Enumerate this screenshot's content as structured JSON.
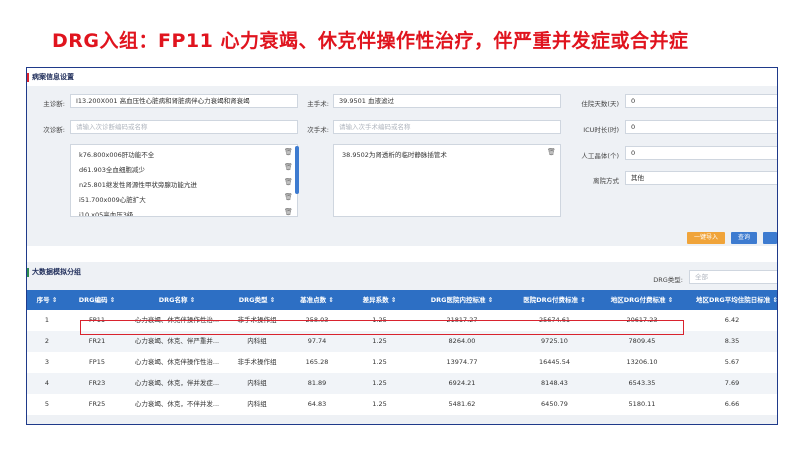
{
  "slide_title": "DRG入组：FP11 心力衰竭、休克伴操作性治疗，伴严重并发症或合并症",
  "section1": {
    "title": "病案信息设置",
    "main_diag_label": "主诊断:",
    "main_diag_value": "I13.200X001 高血压性心脏病和肾脏病伴心力衰竭和肾衰竭",
    "secondary_diag_label": "次诊断:",
    "secondary_diag_placeholder": "请输入次诊断编码或名称",
    "secondary_list": [
      "k76.800x006肝功能不全",
      "d61.903全血细胞减少",
      "n25.801继发性肾源性甲状旁腺功能亢进",
      "i51.700x009心脏扩大",
      "i10.x05高血压3级"
    ],
    "main_op_label": "主手术:",
    "main_op_value": "39.9501 血液滤过",
    "secondary_op_label": "次手术:",
    "secondary_op_placeholder": "请输入次手术编码或名称",
    "secondary_op_list": [
      "38.9502为肾透析的临时静脉插管术"
    ],
    "los_label": "住院天数(天)",
    "los_value": "0",
    "icu_label": "ICU时长(时)",
    "icu_value": "0",
    "ventilator_label": "人工晶体(个)",
    "ventilator_value": "0",
    "discharge_label": "离院方式",
    "discharge_value": "其他",
    "import_button": "一键导入",
    "query_button": "查询"
  },
  "section2": {
    "title": "大数据模拟分组",
    "drg_type_label": "DRG类型:",
    "drg_type_value": "全部",
    "columns": [
      "序号 ⇕",
      "DRG编码 ⇕",
      "DRG名称 ⇕",
      "DRG类型 ⇕",
      "基准点数 ⇕",
      "差异系数 ⇕",
      "DRG医院内控标准 ⇕",
      "医院DRG付费标准 ⇕",
      "地区DRG付费标准 ⇕",
      "地区DRG平均住院日标准 ⇕"
    ],
    "rows": [
      [
        "1",
        "FP11",
        "心力衰竭、休克伴操作性治...",
        "非手术操作组",
        "258.03",
        "1.25",
        "21817.27",
        "25674.61",
        "20617.23",
        "6.42"
      ],
      [
        "2",
        "FR21",
        "心力衰竭、休克、伴严重并...",
        "内科组",
        "97.74",
        "1.25",
        "8264.00",
        "9725.10",
        "7809.45",
        "8.35"
      ],
      [
        "3",
        "FP15",
        "心力衰竭、休克伴操作性治...",
        "非手术操作组",
        "165.28",
        "1.25",
        "13974.77",
        "16445.54",
        "13206.10",
        "5.67"
      ],
      [
        "4",
        "FR23",
        "心力衰竭、休克，伴并发症...",
        "内科组",
        "81.89",
        "1.25",
        "6924.21",
        "8148.43",
        "6543.35",
        "7.69"
      ],
      [
        "5",
        "FR25",
        "心力衰竭、休克，不伴并发...",
        "内科组",
        "64.83",
        "1.25",
        "5481.62",
        "6450.79",
        "5180.11",
        "6.66"
      ]
    ]
  },
  "colors": {
    "title_red": "#e0141e",
    "header_blue": "#2d6fc4",
    "import_orange": "#f0a43a",
    "query_blue": "#3d7bd0",
    "highlight_red": "#d9232e"
  },
  "icons": {
    "delete": "trash-icon"
  }
}
